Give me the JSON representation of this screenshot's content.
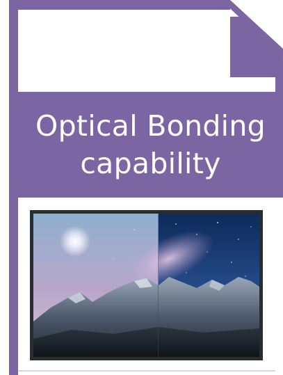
{
  "banner": {
    "line1": "Optical Bonding",
    "line2": "capability"
  },
  "colors": {
    "accent": "#7b65a3",
    "background": "#ffffff",
    "text": "#ffffff"
  },
  "icons": {
    "document": "document-icon",
    "illustration": "mountain-night-sky-illustration"
  }
}
